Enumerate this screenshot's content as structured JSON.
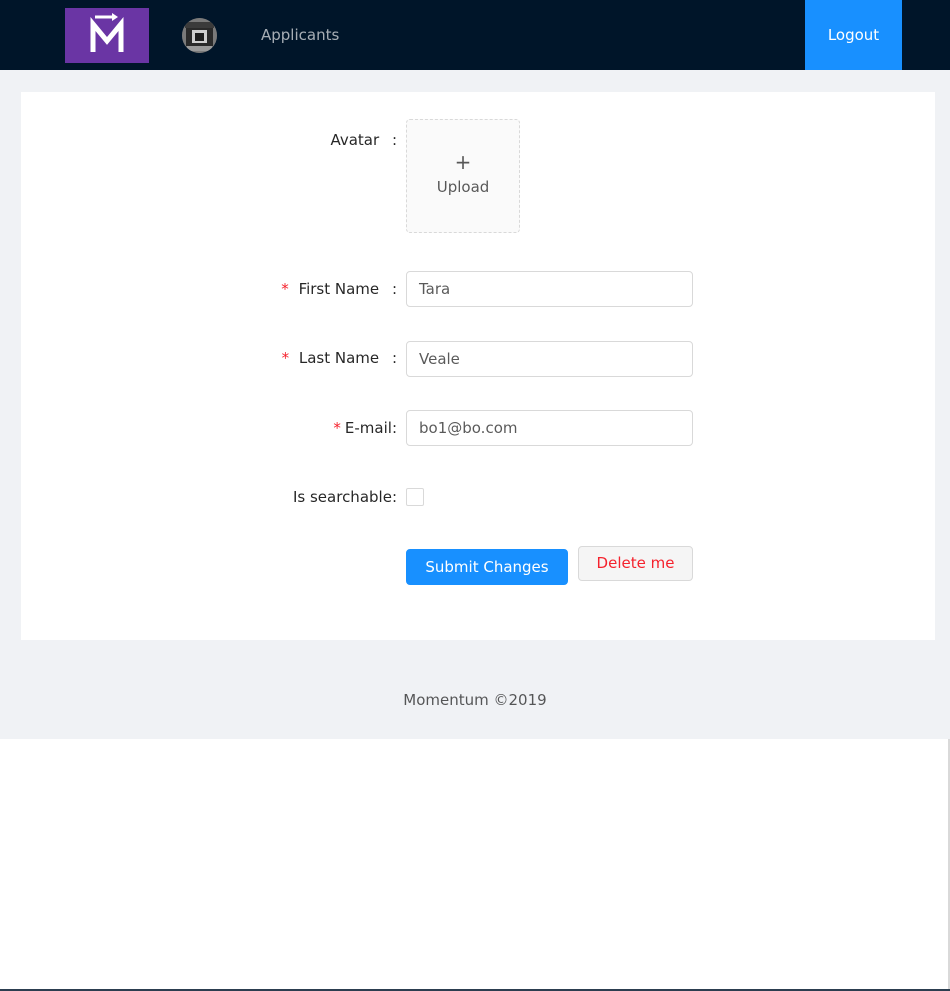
{
  "header": {
    "logo_text": "M",
    "nav_link": "Applicants",
    "logout_label": "Logout"
  },
  "form": {
    "avatar_label": "Avatar",
    "upload_icon": "+",
    "upload_text": "Upload",
    "required_mark": "*",
    "first_name_label": "First Name",
    "first_name_value": "Tara",
    "last_name_label": "Last Name",
    "last_name_value": "Veale",
    "email_label": "E-mail",
    "email_value": "bo1@bo.com",
    "searchable_label": "Is searchable",
    "searchable_checked": false,
    "label_colon": ":",
    "submit_label": "Submit Changes",
    "delete_label": "Delete me"
  },
  "footer": {
    "text": "Momentum ©2019"
  },
  "colors": {
    "header_bg": "#001529",
    "logo_bg": "#6a35a4",
    "primary": "#1890ff",
    "danger": "#f5222d",
    "page_bg": "#f0f2f5"
  },
  "icons": {
    "logo": "momentum-logo-icon",
    "avatar": "user-avatar-icon",
    "upload": "plus-icon"
  }
}
